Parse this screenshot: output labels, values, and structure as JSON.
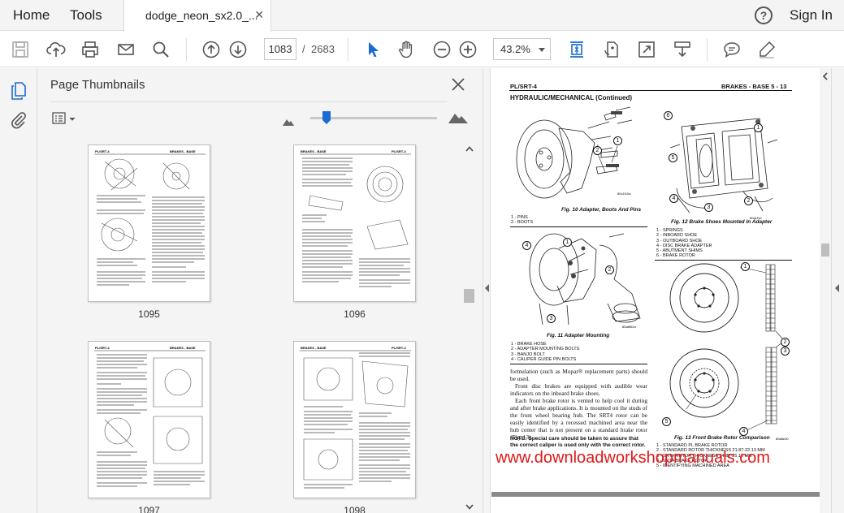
{
  "topbar": {
    "home_label": "Home",
    "tools_label": "Tools",
    "document_tab": "dodge_neon_sx2.0_...",
    "help_label": "?",
    "sign_in_label": "Sign In"
  },
  "toolbar": {
    "current_page": "1083",
    "page_separator": "/",
    "total_pages": "2683",
    "zoom": "43.2%"
  },
  "thumbnails_panel": {
    "title": "Page Thumbnails",
    "pages": [
      {
        "label": "1095",
        "header_left": "PL/SRT-4",
        "header_right": "BRAKES - BASE"
      },
      {
        "label": "1096",
        "header_left": "BRAKES - BASE",
        "header_right": "PL/SRT-4"
      },
      {
        "label": "1097",
        "header_left": "PL/SRT-4",
        "header_right": "BRAKES - BASE"
      },
      {
        "label": "1098",
        "header_left": "BRAKES - BASE",
        "header_right": "PL/SRT-4"
      }
    ]
  },
  "document": {
    "header_left": "PL/SRT-4",
    "header_right": "BRAKES - BASE    5 - 13",
    "section_title": "HYDRAULIC/MECHANICAL (Continued)",
    "figure_10": {
      "caption": "Fig. 10 Adapter, Boots And Pins",
      "code": "80c1f10a",
      "legend": [
        "1 - PINS",
        "2 - BOOTS"
      ]
    },
    "figure_11": {
      "caption": "Fig. 11 Adapter Mounting",
      "code": "80a8f02a",
      "legend": [
        "1 - BRAKE HOSE",
        "2 - ADAPTER MOUNTING BOLTS",
        "3 - BANJO BOLT",
        "4 - CALIPER GUIDE PIN BOLTS"
      ]
    },
    "figure_12": {
      "caption": "Fig. 12 Brake Shoes Mounted In Adapter",
      "code": "80a1f1d",
      "legend": [
        "1 - SPRINGS",
        "2 - INBOARD SHOE",
        "3 - OUTBOARD SHOE",
        "4 - DISC BRAKE ADAPTER",
        "5 - ABUTMENT SHIMS",
        "6 - BRAKE ROTOR"
      ]
    },
    "figure_13": {
      "caption": "Fig. 13 Front Brake Rotor Comparison",
      "code": "80a8e30",
      "legend": [
        "1 - STANDARD PL BRAKE ROTOR",
        "2 - STANDARD ROTOR THICKNESS 21.87-22.13 MM",
        "3 - SRT4 ROTOR THICKNESS 24.87-25.13 MM",
        "4 - SRT4 BRAKE ROTOR",
        "5 - IDENTIFYING MACHINED AREA"
      ]
    },
    "body_paragraphs": [
      "formulation (such as Mopar® replacement parts) should be used.",
      "Front disc brakes are equipped with audible wear indicators on the inboard brake shoes.",
      "Each front brake rotor is vented to help cool it during and after brake applications. It is mounted on the studs of the front wheel bearing hub. The SRT4 rotor can be easily identified by a recessed machined area near the hub center that is not present on a standard brake rotor (Fig. 13)."
    ],
    "note": "NOTE: Special care should be taken to assure that the correct caliper is used only with the correct rotor.",
    "watermark": "www.downloadworkshopmanuals.com"
  }
}
